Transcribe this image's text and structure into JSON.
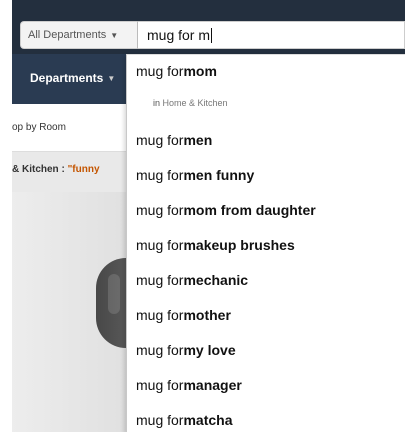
{
  "search": {
    "department": "All Departments",
    "query": "mug for m"
  },
  "nav": {
    "departments": "Departments"
  },
  "sub_nav": {
    "shop_by_room": "op by Room"
  },
  "breadcrumb": {
    "category": "& Kitchen : ",
    "query": "\"funny"
  },
  "dropdown": {
    "in_department_prefix": "in",
    "in_department": "Home & Kitchen",
    "typed": "mug for ",
    "suggestions": [
      {
        "rest": "mom"
      },
      {
        "rest": "men"
      },
      {
        "rest": "men funny"
      },
      {
        "rest": "mom from daughter"
      },
      {
        "rest": "makeup brushes"
      },
      {
        "rest": "mechanic"
      },
      {
        "rest": "mother"
      },
      {
        "rest": "my love"
      },
      {
        "rest": "manager"
      },
      {
        "rest": "matcha"
      }
    ]
  },
  "colors": {
    "header_bg": "#232f3e",
    "nav_bg": "#2a3b52",
    "query_accent": "#c45500"
  }
}
